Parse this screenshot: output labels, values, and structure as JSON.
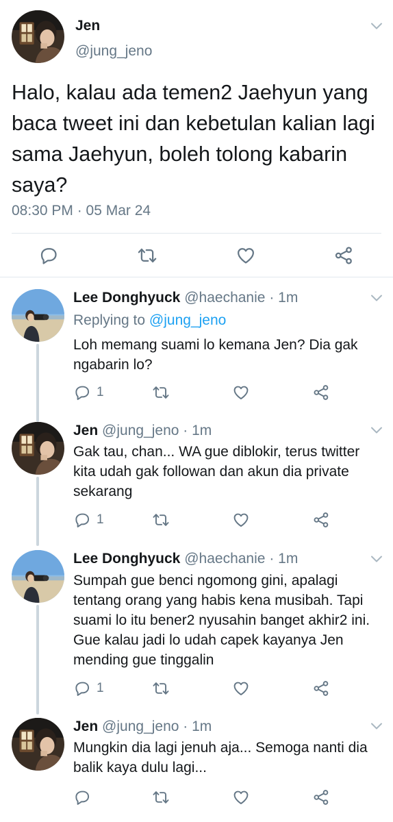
{
  "main_tweet": {
    "name": "Jen",
    "handle": "@jung_jeno",
    "text": "Halo, kalau ada temen2 Jaehyun yang baca tweet ini dan kebetulan kalian lagi sama Jaehyun, boleh tolong kabarin saya?",
    "timestamp": "08:30 PM · 05 Mar 24",
    "actions": [
      "reply-icon",
      "retweet-icon",
      "like-icon",
      "share-icon"
    ]
  },
  "replies": [
    {
      "name": "Lee Donghyuck",
      "handle": "@haechanie",
      "time": "· 1m",
      "replying_prefix": "Replying to ",
      "replying_to": "@jung_jeno",
      "text": "Loh memang suami lo kemana Jen? Dia gak ngabarin lo?",
      "reply_count": "1"
    },
    {
      "name": "Jen",
      "handle": "@jung_jeno",
      "time": "· 1m",
      "text": "Gak tau, chan... WA gue diblokir, terus twitter kita udah gak followan dan akun dia private sekarang",
      "reply_count": "1"
    },
    {
      "name": "Lee Donghyuck",
      "handle": "@haechanie",
      "time": "· 1m",
      "text": "Sumpah gue benci ngomong gini, apalagi tentang orang yang habis kena musibah. Tapi suami lo itu bener2 nyusahin banget akhir2 ini. Gue kalau jadi lo udah capek kayanya Jen mending gue tinggalin",
      "reply_count": "1"
    },
    {
      "name": "Jen",
      "handle": "@jung_jeno",
      "time": "· 1m",
      "text": "Mungkin dia lagi jenuh aja... Semoga nanti dia balik kaya dulu lagi...",
      "reply_count": ""
    }
  ],
  "colors": {
    "text": "#14171a",
    "secondary": "#657786",
    "link": "#1da1f2",
    "divider": "#e1e8ed",
    "thread_line": "#ccd6dd"
  }
}
